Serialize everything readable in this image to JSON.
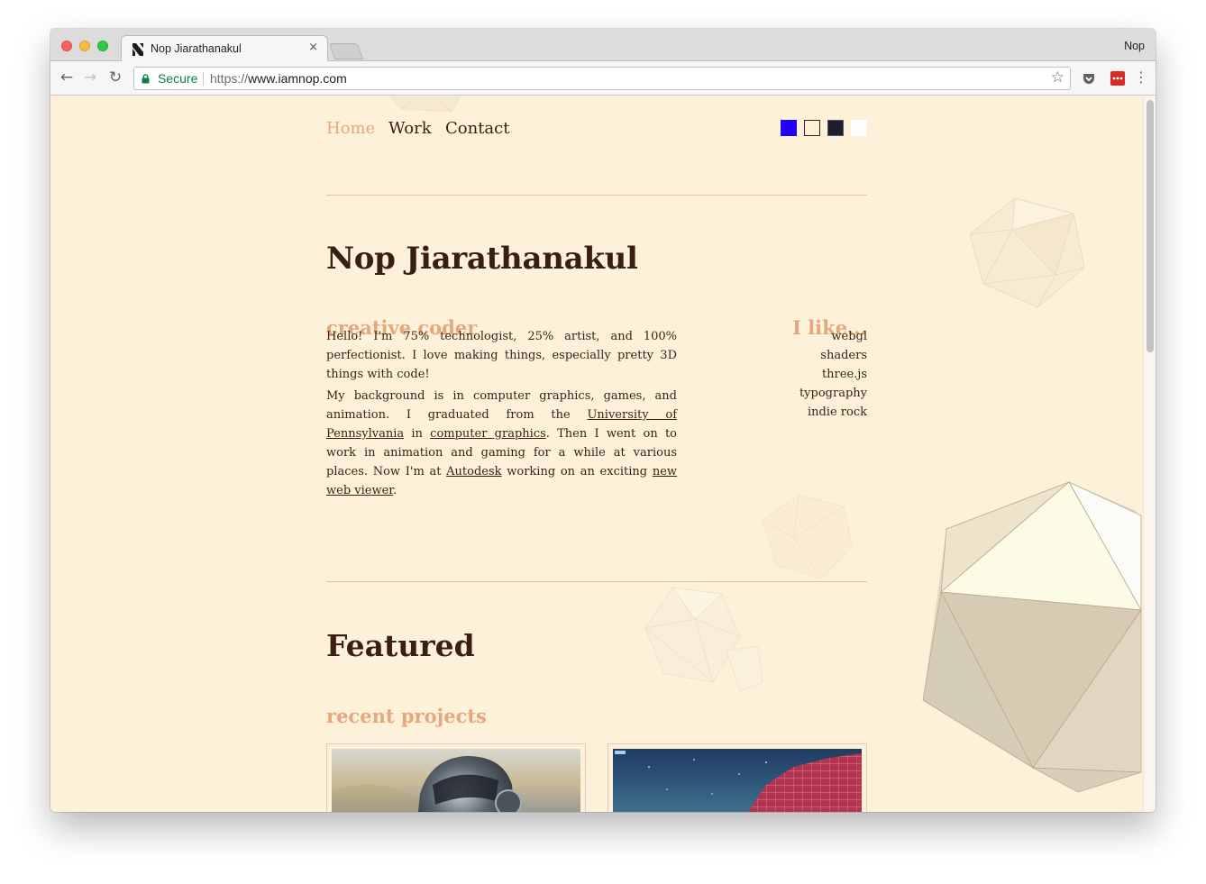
{
  "browser": {
    "tab_title": "Nop Jiarathanakul",
    "tab_close": "×",
    "profile_name": "Nop",
    "secure_label": "Secure",
    "url_scheme": "https://",
    "url_host": "www.iamnop.com",
    "back_glyph": "←",
    "forward_glyph": "→",
    "reload_glyph": "↻",
    "star_glyph": "☆",
    "menu_glyph": "⋮",
    "icons": [
      "back-arrow-icon",
      "forward-arrow-icon",
      "reload-icon",
      "lock-icon",
      "star-icon",
      "pocket-icon",
      "lastpass-icon",
      "menu-icon"
    ]
  },
  "nav": {
    "links": [
      {
        "label": "Home",
        "active": true
      },
      {
        "label": "Work",
        "active": false
      },
      {
        "label": "Contact",
        "active": false
      }
    ],
    "theme_swatches": [
      "#2200ff",
      "#fdf1d9",
      "#1e1b2e",
      "#ffffff"
    ]
  },
  "hero": {
    "name": "Nop Jiarathanakul",
    "tagline": "creative coder",
    "intro": "Hello! I'm 75% technologist, 25% artist, and 100% perfectionist. I love making things, especially pretty 3D things with code!",
    "bio": {
      "t1": "My background is in computer graphics, games, and animation. I graduated from the ",
      "link1": "University of Pennsylvania",
      "t2": " in ",
      "link2": "computer graphics",
      "t3": ". Then I went on to work in animation and gaming for a while at various places. Now I'm at ",
      "link3": "Autodesk",
      "t4": " working on an exciting ",
      "link4": "new web viewer",
      "t5": "."
    }
  },
  "likes": {
    "heading": "I like...",
    "items": [
      "webgl",
      "shaders",
      "three.js",
      "typography",
      "indie rock"
    ]
  },
  "featured": {
    "title": "Featured",
    "subtitle": "recent projects"
  },
  "colors": {
    "background": "#fdf1d9",
    "text": "#3a1f10",
    "accent": "#e5a87e",
    "rule": "#e5bfb0"
  }
}
